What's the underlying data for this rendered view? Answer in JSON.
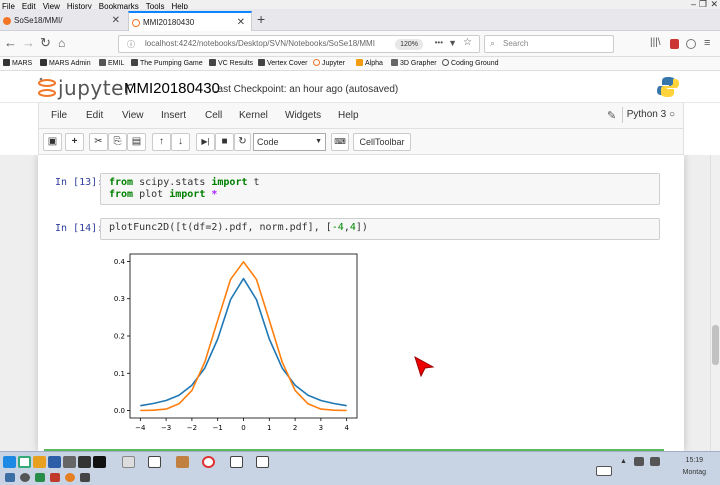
{
  "firefox_menu": [
    "File",
    "Edit",
    "View",
    "History",
    "Bookmarks",
    "Tools",
    "Help"
  ],
  "tabs": [
    {
      "title": "SoSe18/MMI/",
      "active": false
    },
    {
      "title": "MMI20180430",
      "active": true
    }
  ],
  "nav": {
    "url": "localhost:4242/notebooks/Desktop/SVN/Notebooks/SoSe18/MMI",
    "zoom": "120%",
    "search_placeholder": "Search",
    "more": "•••"
  },
  "bookmarks": [
    "MARS",
    "MARS Admin",
    "EMIL",
    "The Pumping Game",
    "VC Results",
    "Vertex Cover",
    "Jupyter",
    "Alpha",
    "3D Grapher",
    "Coding Ground"
  ],
  "jupyter": {
    "logo_text": "jupyter",
    "notebook_name": "MMI20180430",
    "checkpoint": "Last Checkpoint: an hour ago (autosaved)",
    "menu": [
      "File",
      "Edit",
      "View",
      "Insert",
      "Cell",
      "Kernel",
      "Widgets",
      "Help"
    ],
    "kernel_name": "Python 3",
    "cell_type": "Code",
    "celltoolbar_label": "CellToolbar"
  },
  "cells": [
    {
      "prompt": "In [13]:",
      "line1_kw1": "from",
      "line1_mod": " scipy.stats ",
      "line1_kw2": "import",
      "line1_name": " t",
      "line2_kw1": "from",
      "line2_mod": " plot ",
      "line2_kw2": "import",
      "line2_star": " *"
    },
    {
      "prompt": "In [14]:",
      "code_fn": "plotFunc2D([t(df=2).pdf, norm.pdf], [",
      "code_num1": "-4",
      "code_sep": ",",
      "code_num2": "4",
      "code_end": "])"
    }
  ],
  "chart_data": {
    "type": "line",
    "xlim": [
      -4.4,
      4.4
    ],
    "ylim": [
      -0.02,
      0.42
    ],
    "xticks": [
      "−4",
      "−3",
      "−2",
      "−1",
      "0",
      "1",
      "2",
      "3",
      "4"
    ],
    "yticks": [
      "0.0",
      "0.1",
      "0.2",
      "0.3",
      "0.4"
    ],
    "grid": false,
    "series": [
      {
        "color": "#1f77b4",
        "x": [
          -4,
          -3.5,
          -3,
          -2.5,
          -2,
          -1.5,
          -1,
          -0.5,
          0,
          0.5,
          1,
          1.5,
          2,
          2.5,
          3,
          3.5,
          4
        ],
        "y": [
          0.013,
          0.019,
          0.027,
          0.041,
          0.068,
          0.114,
          0.192,
          0.298,
          0.354,
          0.298,
          0.192,
          0.114,
          0.068,
          0.041,
          0.027,
          0.019,
          0.013
        ]
      },
      {
        "color": "#ff7f0e",
        "x": [
          -4,
          -3.5,
          -3,
          -2.5,
          -2,
          -1.5,
          -1,
          -0.5,
          0,
          0.5,
          1,
          1.5,
          2,
          2.5,
          3,
          3.5,
          4
        ],
        "y": [
          0.0001,
          0.0009,
          0.004,
          0.018,
          0.054,
          0.13,
          0.242,
          0.352,
          0.399,
          0.352,
          0.242,
          0.13,
          0.054,
          0.018,
          0.004,
          0.0009,
          0.0001
        ]
      }
    ]
  },
  "clock": {
    "time": "15:19",
    "day": "Montag"
  }
}
